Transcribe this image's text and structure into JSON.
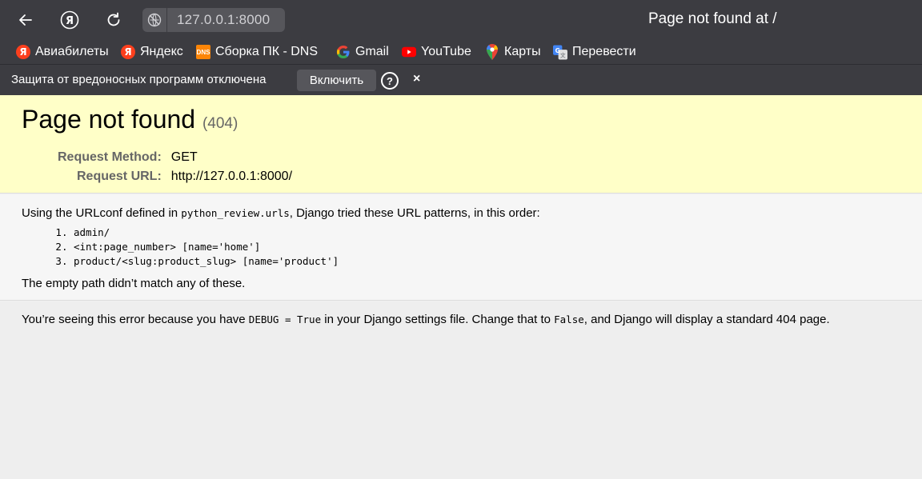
{
  "browser": {
    "address": "127.0.0.1:8000",
    "tab_title": "Page not found at /",
    "bookmarks": [
      {
        "label": "Авиабилеты",
        "icon": "yandex-icon"
      },
      {
        "label": "Яндекс",
        "icon": "yandex-icon"
      },
      {
        "label": "Сборка ПК - DNS",
        "icon": "dns-icon"
      },
      {
        "label": "Gmail",
        "icon": "google-icon"
      },
      {
        "label": "YouTube",
        "icon": "youtube-icon"
      },
      {
        "label": "Карты",
        "icon": "maps-pin-icon"
      },
      {
        "label": "Перевести",
        "icon": "translate-icon"
      }
    ],
    "security_bar": {
      "message": "Защита от вредоносных программ отключена",
      "enable_label": "Включить",
      "help_label": "?",
      "close_label": "×"
    }
  },
  "page": {
    "title": "Page not found",
    "status_code": "(404)",
    "meta": [
      {
        "label": "Request Method:",
        "value": "GET"
      },
      {
        "label": "Request URL:",
        "value": "http://127.0.0.1:8000/"
      }
    ],
    "intro_before": "Using the URLconf defined in ",
    "urlconf": "python_review.urls",
    "intro_after": ", Django tried these URL patterns, in this order:",
    "patterns": [
      "admin/",
      "<int:page_number> [name='home']",
      "product/<slug:product_slug> [name='product']"
    ],
    "outro": "The empty path didn’t match any of these.",
    "explanation": {
      "before": "You’re seeing this error because you have ",
      "debug_code": "DEBUG = True",
      "middle": " in your Django settings file. Change that to ",
      "false_code": "False",
      "after": ", and Django will display a standard 404 page."
    }
  },
  "colors": {
    "chrome_bg": "#3c3c41",
    "summary_bg": "#ffffc8",
    "info_bg": "#f6f6f6",
    "explanation_bg": "#eeeeee"
  }
}
